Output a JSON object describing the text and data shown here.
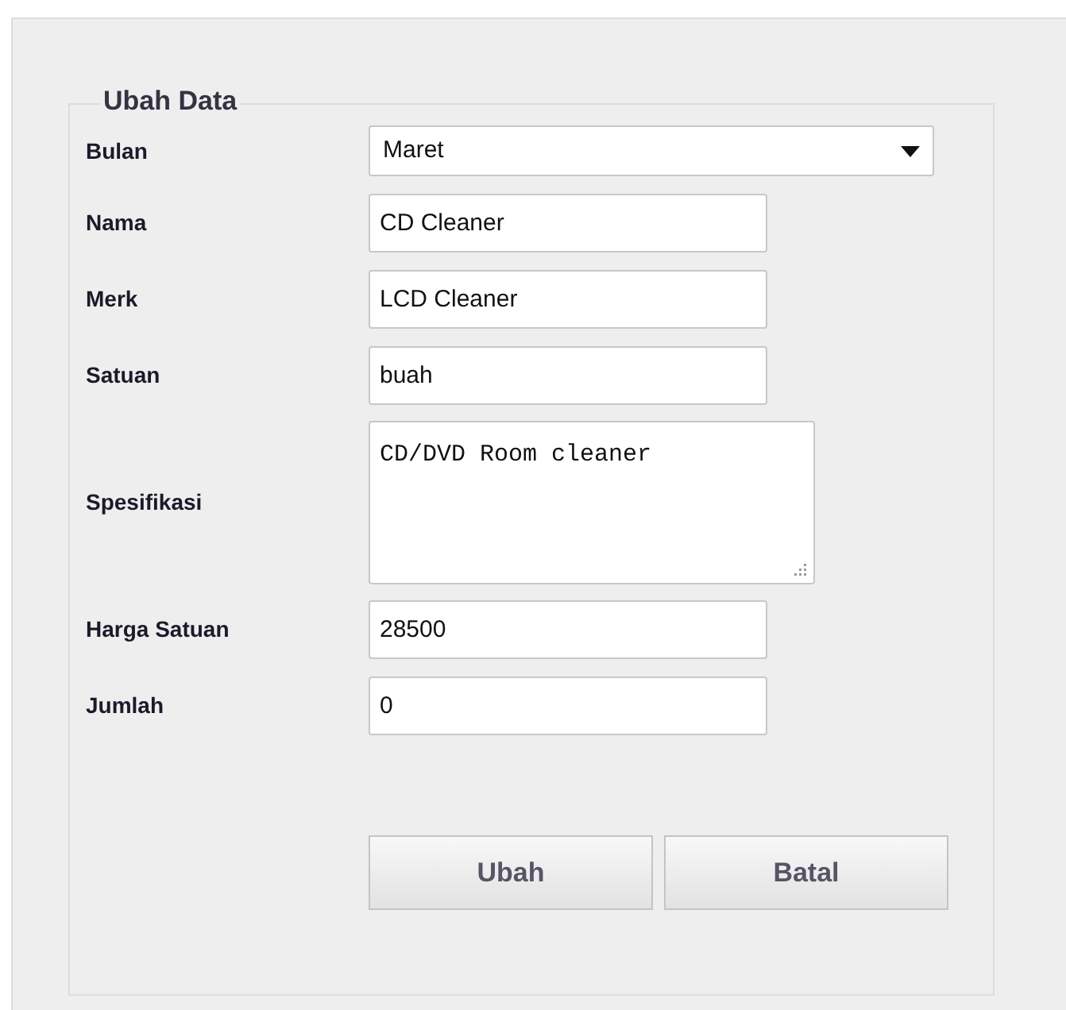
{
  "form": {
    "legend": "Ubah Data",
    "fields": [
      {
        "kind": "select",
        "label": "Bulan",
        "value": "Maret"
      },
      {
        "kind": "text",
        "label": "Nama",
        "value": "CD Cleaner"
      },
      {
        "kind": "text",
        "label": "Merk",
        "value": "LCD Cleaner"
      },
      {
        "kind": "text",
        "label": "Satuan",
        "value": "buah"
      },
      {
        "kind": "textarea",
        "label": "Spesifikasi",
        "value": "CD/DVD Room cleaner"
      },
      {
        "kind": "text",
        "label": "Harga Satuan",
        "value": "28500"
      },
      {
        "kind": "text",
        "label": "Jumlah",
        "value": "0"
      }
    ],
    "buttons": [
      "Ubah",
      "Batal"
    ]
  }
}
